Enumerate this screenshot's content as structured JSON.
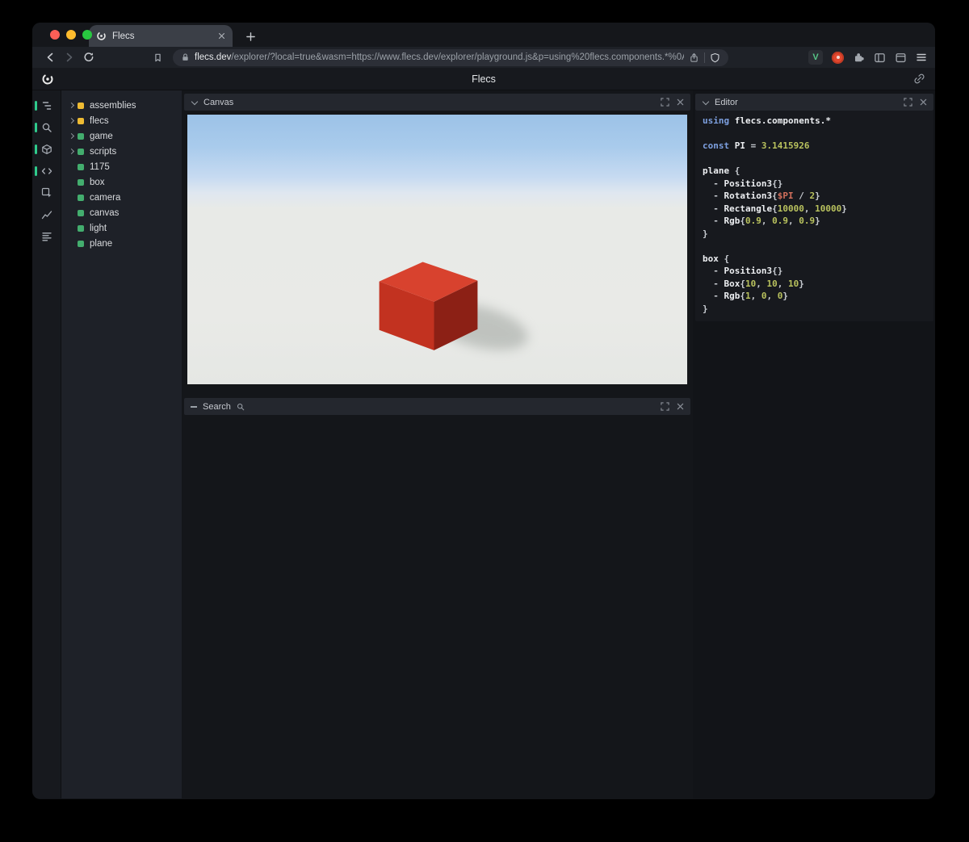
{
  "browser": {
    "tab_title": "Flecs",
    "url_domain": "flecs.dev",
    "url_rest": "/explorer/?local=true&wasm=https://www.flecs.dev/explorer/playground.js&p=using%20flecs.components.*%0A…",
    "extension_v_label": "V"
  },
  "app": {
    "header_title": "Flecs"
  },
  "sidebar_icons": [
    {
      "name": "entity-tree-icon",
      "active": true
    },
    {
      "name": "search-icon",
      "active": true
    },
    {
      "name": "canvas-3d-icon",
      "active": true
    },
    {
      "name": "code-editor-icon",
      "active": true
    },
    {
      "name": "inspector-icon",
      "active": false
    },
    {
      "name": "stats-chart-icon",
      "active": false
    },
    {
      "name": "queries-icon",
      "active": false
    }
  ],
  "tree": {
    "items": [
      {
        "label": "assemblies",
        "color": "yellow",
        "expandable": true
      },
      {
        "label": "flecs",
        "color": "yellow",
        "expandable": true
      },
      {
        "label": "game",
        "color": "green",
        "expandable": true
      },
      {
        "label": "scripts",
        "color": "green",
        "expandable": true
      },
      {
        "label": "1175",
        "color": "green",
        "expandable": false
      },
      {
        "label": "box",
        "color": "green",
        "expandable": false
      },
      {
        "label": "camera",
        "color": "green",
        "expandable": false
      },
      {
        "label": "canvas",
        "color": "green",
        "expandable": false
      },
      {
        "label": "light",
        "color": "green",
        "expandable": false
      },
      {
        "label": "plane",
        "color": "green",
        "expandable": false
      }
    ]
  },
  "panels": {
    "canvas": {
      "title": "Canvas"
    },
    "search": {
      "title": "Search"
    },
    "editor": {
      "title": "Editor"
    }
  },
  "editor": {
    "code_lines": [
      [
        {
          "t": "using ",
          "c": "kw"
        },
        {
          "t": "flecs.components.*",
          "c": "id"
        }
      ],
      [],
      [
        {
          "t": "const ",
          "c": "kw"
        },
        {
          "t": "PI",
          "c": "id"
        },
        {
          "t": " = ",
          "c": "p"
        },
        {
          "t": "3.1415926",
          "c": "num"
        }
      ],
      [],
      [
        {
          "t": "plane",
          "c": "id"
        },
        {
          "t": " {",
          "c": "p"
        }
      ],
      [
        {
          "t": "  - ",
          "c": "p"
        },
        {
          "t": "Position3",
          "c": "id"
        },
        {
          "t": "{}",
          "c": "p"
        }
      ],
      [
        {
          "t": "  - ",
          "c": "p"
        },
        {
          "t": "Rotation3",
          "c": "id"
        },
        {
          "t": "{",
          "c": "p"
        },
        {
          "t": "$PI",
          "c": "var"
        },
        {
          "t": " / ",
          "c": "p"
        },
        {
          "t": "2",
          "c": "num"
        },
        {
          "t": "}",
          "c": "p"
        }
      ],
      [
        {
          "t": "  - ",
          "c": "p"
        },
        {
          "t": "Rectangle",
          "c": "id"
        },
        {
          "t": "{",
          "c": "p"
        },
        {
          "t": "10000",
          "c": "num"
        },
        {
          "t": ", ",
          "c": "p"
        },
        {
          "t": "10000",
          "c": "num"
        },
        {
          "t": "}",
          "c": "p"
        }
      ],
      [
        {
          "t": "  - ",
          "c": "p"
        },
        {
          "t": "Rgb",
          "c": "id"
        },
        {
          "t": "{",
          "c": "p"
        },
        {
          "t": "0.9",
          "c": "num"
        },
        {
          "t": ", ",
          "c": "p"
        },
        {
          "t": "0.9",
          "c": "num"
        },
        {
          "t": ", ",
          "c": "p"
        },
        {
          "t": "0.9",
          "c": "num"
        },
        {
          "t": "}",
          "c": "p"
        }
      ],
      [
        {
          "t": "}",
          "c": "p"
        }
      ],
      [],
      [
        {
          "t": "box",
          "c": "id"
        },
        {
          "t": " {",
          "c": "p"
        }
      ],
      [
        {
          "t": "  - ",
          "c": "p"
        },
        {
          "t": "Position3",
          "c": "id"
        },
        {
          "t": "{}",
          "c": "p"
        }
      ],
      [
        {
          "t": "  - ",
          "c": "p"
        },
        {
          "t": "Box",
          "c": "id"
        },
        {
          "t": "{",
          "c": "p"
        },
        {
          "t": "10",
          "c": "num"
        },
        {
          "t": ", ",
          "c": "p"
        },
        {
          "t": "10",
          "c": "num"
        },
        {
          "t": ", ",
          "c": "p"
        },
        {
          "t": "10",
          "c": "num"
        },
        {
          "t": "}",
          "c": "p"
        }
      ],
      [
        {
          "t": "  - ",
          "c": "p"
        },
        {
          "t": "Rgb",
          "c": "id"
        },
        {
          "t": "{",
          "c": "p"
        },
        {
          "t": "1",
          "c": "num"
        },
        {
          "t": ", ",
          "c": "p"
        },
        {
          "t": "0",
          "c": "num"
        },
        {
          "t": ", ",
          "c": "p"
        },
        {
          "t": "0",
          "c": "num"
        },
        {
          "t": "}",
          "c": "p"
        }
      ],
      [
        {
          "t": "}",
          "c": "p"
        }
      ]
    ]
  },
  "colors": {
    "entity_yellow": "#eebb33",
    "entity_green": "#43ad6e",
    "active_indicator": "#2fcb8c",
    "box_top": "#d8422e",
    "box_front": "#c23220",
    "box_side": "#8c2015"
  }
}
